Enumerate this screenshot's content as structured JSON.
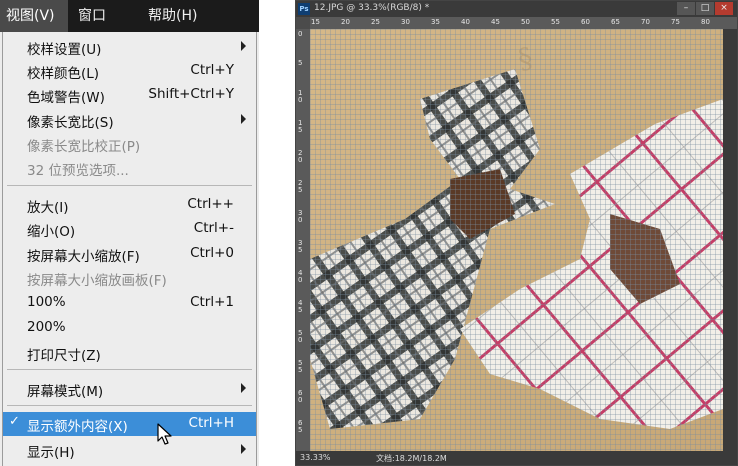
{
  "menubar": {
    "items": [
      {
        "label": "视图(V)"
      },
      {
        "label": "窗口(W)"
      },
      {
        "label": "帮助(H)"
      }
    ]
  },
  "menu": {
    "items": [
      {
        "label": "校样设置(U)",
        "shortcut": "",
        "submenu": true,
        "disabled": false
      },
      {
        "label": "校样颜色(L)",
        "shortcut": "Ctrl+Y",
        "submenu": false,
        "disabled": false
      },
      {
        "label": "色域警告(W)",
        "shortcut": "Shift+Ctrl+Y",
        "submenu": false,
        "disabled": false
      },
      {
        "label": "像素长宽比(S)",
        "shortcut": "",
        "submenu": true,
        "disabled": false
      },
      {
        "label": "像素长宽比校正(P)",
        "shortcut": "",
        "submenu": false,
        "disabled": true
      },
      {
        "label": "32 位预览选项...",
        "shortcut": "",
        "submenu": false,
        "disabled": true
      },
      {
        "label": "放大(I)",
        "shortcut": "Ctrl++",
        "submenu": false,
        "disabled": false
      },
      {
        "label": "缩小(O)",
        "shortcut": "Ctrl+-",
        "submenu": false,
        "disabled": false
      },
      {
        "label": "按屏幕大小缩放(F)",
        "shortcut": "Ctrl+0",
        "submenu": false,
        "disabled": false
      },
      {
        "label": "按屏幕大小缩放画板(F)",
        "shortcut": "",
        "submenu": false,
        "disabled": true
      },
      {
        "label": "100%",
        "shortcut": "Ctrl+1",
        "submenu": false,
        "disabled": false
      },
      {
        "label": "200%",
        "shortcut": "",
        "submenu": false,
        "disabled": false
      },
      {
        "label": "打印尺寸(Z)",
        "shortcut": "",
        "submenu": false,
        "disabled": false
      },
      {
        "label": "屏幕模式(M)",
        "shortcut": "",
        "submenu": true,
        "disabled": false
      },
      {
        "label": "显示额外内容(X)",
        "shortcut": "Ctrl+H",
        "submenu": false,
        "disabled": false,
        "checked": true,
        "selected": true
      },
      {
        "label": "显示(H)",
        "shortcut": "",
        "submenu": true,
        "disabled": false
      }
    ]
  },
  "photoshop": {
    "logo": "Ps",
    "title": "12.JPG @ 33.3%(RGB/8) *",
    "ruler_top": [
      "15",
      "20",
      "25",
      "30",
      "35",
      "40",
      "45",
      "50",
      "55",
      "60",
      "65",
      "70",
      "75",
      "80"
    ],
    "ruler_left": [
      "0",
      "5",
      "1 0",
      "1 5",
      "2 0",
      "2 5",
      "3 0",
      "3 5",
      "4 0",
      "4 5",
      "5 0",
      "5 5",
      "6 0",
      "6 5"
    ],
    "status_zoom": "33.33%",
    "status_doc": "文档:18.2M/18.2M"
  },
  "colors": {
    "menubar_bg": "#1b1b1b",
    "menu_bg": "#ededed",
    "highlight": "#3c8ed8",
    "disabled_text": "#8a8a8a"
  }
}
